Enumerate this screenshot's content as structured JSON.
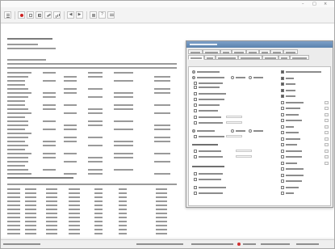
{
  "window": {
    "title": ""
  },
  "toolbar": {
    "icons": [
      "menu-icon",
      "stop-icon",
      "table-icon",
      "grid-icon",
      "edit-icon",
      "chart-icon",
      "nav-prev-icon",
      "nav-next-icon",
      "print-icon",
      "help-icon",
      "options-icon"
    ]
  },
  "dialog": {
    "title": "",
    "tabs": [
      {
        "label": ""
      },
      {
        "label": ""
      },
      {
        "label": ""
      },
      {
        "label": ""
      },
      {
        "label": ""
      },
      {
        "label": ""
      },
      {
        "label": ""
      },
      {
        "label": ""
      },
      {
        "label": ""
      },
      {
        "label": ""
      },
      {
        "label": ""
      },
      {
        "label": ""
      },
      {
        "label": ""
      },
      {
        "label": ""
      },
      {
        "label": ""
      }
    ],
    "left_options": [
      {
        "kind": "radio",
        "checked": true
      },
      {
        "kind": "radio",
        "checked": true
      },
      {
        "kind": "check",
        "checked": false
      },
      {
        "kind": "check",
        "checked": false
      },
      {
        "kind": "check",
        "checked": false
      },
      {
        "kind": "check",
        "checked": false
      },
      {
        "kind": "check",
        "checked": false
      },
      {
        "kind": "check",
        "checked": false
      },
      {
        "kind": "check",
        "checked": false
      },
      {
        "kind": "check",
        "checked": false
      },
      {
        "kind": "radio",
        "checked": true
      },
      {
        "kind": "check",
        "checked": false
      },
      {
        "kind": "check",
        "checked": false
      },
      {
        "kind": "check",
        "checked": false
      },
      {
        "kind": "check",
        "checked": false
      },
      {
        "kind": "check",
        "checked": false
      },
      {
        "kind": "check",
        "checked": false
      },
      {
        "kind": "check",
        "checked": false
      }
    ],
    "right_options": [
      {
        "kind": "check",
        "checked": true
      },
      {
        "kind": "check",
        "checked": true
      },
      {
        "kind": "check",
        "checked": true
      },
      {
        "kind": "check",
        "checked": true
      },
      {
        "kind": "check",
        "checked": true
      },
      {
        "kind": "check",
        "checked": false
      },
      {
        "kind": "check",
        "checked": false
      },
      {
        "kind": "check",
        "checked": false
      },
      {
        "kind": "check",
        "checked": false
      },
      {
        "kind": "check",
        "checked": false
      },
      {
        "kind": "check",
        "checked": false
      },
      {
        "kind": "check",
        "checked": false
      },
      {
        "kind": "check",
        "checked": false
      },
      {
        "kind": "check",
        "checked": false
      },
      {
        "kind": "check",
        "checked": false
      },
      {
        "kind": "check",
        "checked": false
      },
      {
        "kind": "check",
        "checked": false
      },
      {
        "kind": "check",
        "checked": false
      },
      {
        "kind": "check",
        "checked": false
      },
      {
        "kind": "check",
        "checked": false
      },
      {
        "kind": "check",
        "checked": false
      }
    ]
  },
  "statusbar": {
    "items": [
      {
        "text": ""
      },
      {
        "text": ""
      },
      {
        "text": ""
      },
      {
        "text": ""
      },
      {
        "text": ""
      },
      {
        "text": ""
      }
    ]
  },
  "colors": {
    "accent": "#5b82ad",
    "stop_icon": "#cc2222",
    "status_dot": "#d03030"
  }
}
